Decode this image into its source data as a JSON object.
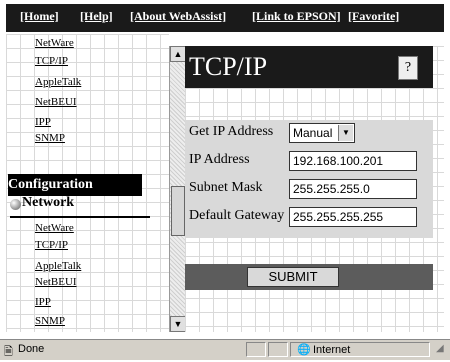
{
  "nav": {
    "home": "[Home]",
    "help": "[Help]",
    "about": "[About WebAssist]",
    "epson": "[Link to EPSON]",
    "favorite": "[Favorite]"
  },
  "left_frame": {
    "top_items": [
      "NetWare",
      "TCP/IP",
      "AppleTalk",
      "NetBEUI",
      "IPP",
      "SNMP"
    ],
    "config_heading": "Configuration",
    "network_heading": "Network",
    "config_items": [
      "NetWare",
      "TCP/IP",
      "AppleTalk",
      "NetBEUI",
      "IPP",
      "SNMP"
    ]
  },
  "main": {
    "title": "TCP/IP",
    "help_glyph": "?",
    "get_ip_label": "Get IP Address",
    "get_ip_value": "Manual",
    "ip_label": "IP Address",
    "ip_value": "192.168.100.201",
    "subnet_label": "Subnet Mask",
    "subnet_value": "255.255.255.0",
    "gateway_label": "Default Gateway",
    "gateway_value": "255.255.255.255",
    "submit_label": "SUBMIT"
  },
  "status": {
    "text": "Done",
    "zone": "Internet"
  }
}
